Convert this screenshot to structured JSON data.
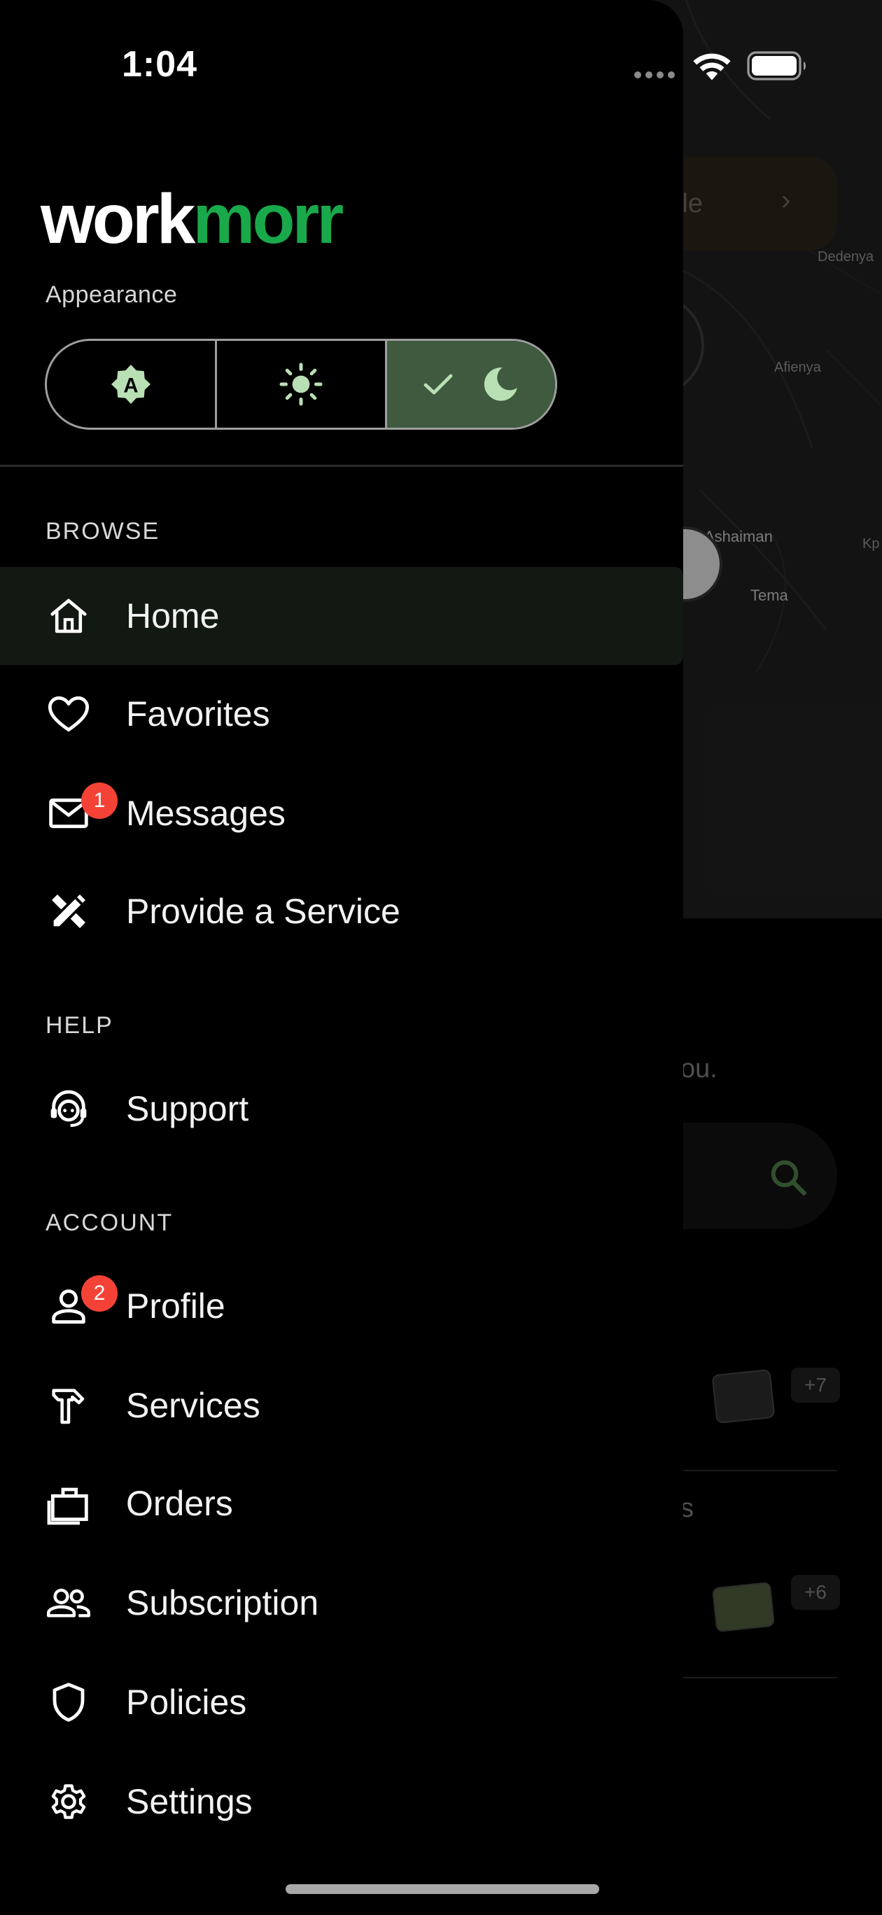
{
  "status_bar": {
    "time": "1:04"
  },
  "brand": {
    "logo_part1": "work",
    "logo_part2": "morr",
    "logo_color": "#19a94a"
  },
  "appearance": {
    "label": "Appearance",
    "options": [
      {
        "name": "auto",
        "icon": "auto-brightness-icon"
      },
      {
        "name": "light",
        "icon": "sun-icon"
      },
      {
        "name": "dark",
        "icon": "moon-icon",
        "selected": true
      }
    ]
  },
  "sections": {
    "browse": "BROWSE",
    "help": "HELP",
    "account": "ACCOUNT"
  },
  "nav": {
    "home": "Home",
    "favorites": "Favorites",
    "messages": "Messages",
    "messages_badge": "1",
    "provide_service": "Provide a Service",
    "support": "Support",
    "profile": "Profile",
    "profile_badge": "2",
    "services": "Services",
    "orders": "Orders",
    "subscription": "Subscription",
    "policies": "Policies",
    "settings": "Settings"
  },
  "background": {
    "profile_pill_text": "ile",
    "map_labels": [
      "Dedenya",
      "Afienya",
      "Ashaiman",
      "Tema",
      "Kp"
    ],
    "text_snippet_1": "ou.",
    "count_1": "+7",
    "text_snippet_2": "s",
    "count_2": "+6"
  },
  "colors": {
    "accent": "#19a94a",
    "active_segment": "#3f5a3f",
    "badge": "#f44336",
    "icon_green": "#b9e0b4"
  }
}
